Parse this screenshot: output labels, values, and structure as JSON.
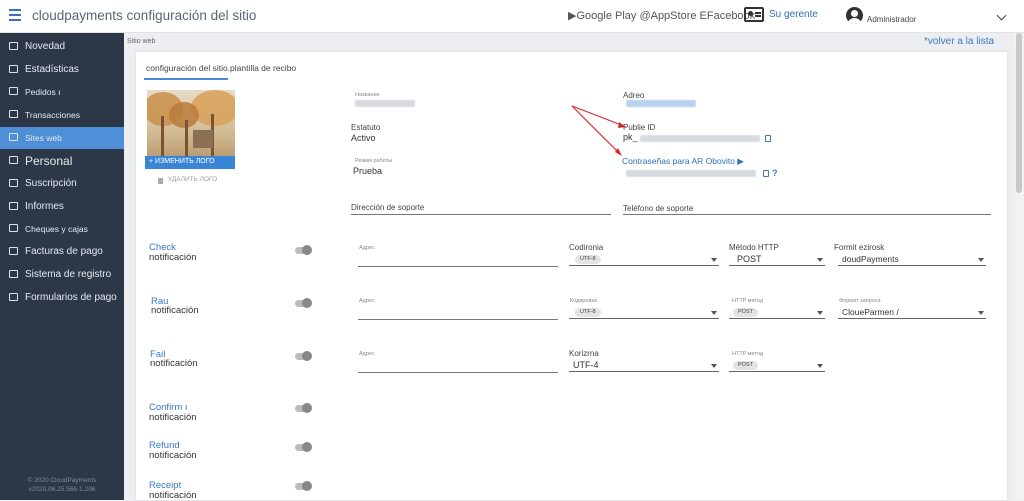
{
  "header": {
    "title": "cloudpayments configuración del sitio",
    "store_links": "▶Google Play @AppStore EFacebook",
    "manager_label": "Su gerente",
    "user_name": "Administrador"
  },
  "sidebar": {
    "items": [
      {
        "label": "Novedad",
        "icon": "news-icon"
      },
      {
        "label": "Estadísticas",
        "icon": "stats-icon"
      },
      {
        "label": "Pedidos ı",
        "icon": "cart-icon"
      },
      {
        "label": "Transacciones",
        "icon": "transactions-icon"
      },
      {
        "label": "Sites web",
        "icon": "globe-icon"
      },
      {
        "label": "Personal",
        "icon": "people-icon"
      },
      {
        "label": "Suscripción",
        "icon": "refresh-icon"
      },
      {
        "label": "Informes",
        "icon": "report-icon"
      },
      {
        "label": "Cheques y cajas",
        "icon": "tag-icon"
      },
      {
        "label": "Facturas de pago",
        "icon": "invoice-icon"
      },
      {
        "label": "Sistema de registro",
        "icon": "home-icon"
      },
      {
        "label": "Formularios de pago",
        "icon": "form-icon"
      }
    ],
    "active_index": 4,
    "copyright": "© 2020 CloudPayments",
    "version": "v2020.06.25.566-1.206"
  },
  "breadcrumb": "Sitio web",
  "back_link": "*volver a la lista",
  "tabs": [
    {
      "label": "configuración del sitio."
    },
    {
      "label": "plantilla de recibo"
    }
  ],
  "logo": {
    "change_button": "+ ИЗМЕНИТЬ ЛОГО",
    "delete_label": "УДАЛИТЬ ЛОГО"
  },
  "site": {
    "name_label": "Название",
    "status_label": "Estatuto",
    "status_value": "Activo",
    "mode_label": "Режим работы",
    "mode_value": "Prueba",
    "address_label": "Adreo",
    "public_id_label": "Publie ID",
    "public_id_prefix": "pk_",
    "passwords_link": "Contraseñas para AR Obovito ▶",
    "support_address_label": "Dirección de soporte",
    "support_phone_label": "Teléfono de soporte"
  },
  "notifications": [
    {
      "title": "Check",
      "subtitle": "notificación",
      "address_label": "Адрес",
      "encoding_label": "Codironia",
      "encoding_value": "UTF-8",
      "method_label": "Método HTTP",
      "method_value": "POST",
      "format_label": "Formit ezirosk",
      "format_value": "doudPayments"
    },
    {
      "title": "Rau",
      "subtitle": "notificación",
      "address_label": "Адрес",
      "encoding_label": "Кодировка",
      "encoding_value": "UTF-8",
      "method_label": "HTTP метод",
      "method_value": "POST",
      "format_label": "Формат запроса",
      "format_value": "CloueParmen /"
    },
    {
      "title": "Fail",
      "subtitle": "notificación",
      "address_label": "Адрес",
      "encoding_label": "Korizrna",
      "encoding_value": "UTF-4",
      "method_label": "HTTP метод",
      "method_value": "POST"
    },
    {
      "title": "Confirm ı",
      "subtitle": "notificación"
    },
    {
      "title": "Refund",
      "subtitle": "notificación"
    },
    {
      "title": "Receipt",
      "subtitle": "notificación"
    }
  ],
  "colors": {
    "sidebar_bg": "#2c3847",
    "active_nav": "#4f8fd8",
    "link": "#3a78c2",
    "arrow_annotation": "#d62b2b"
  }
}
